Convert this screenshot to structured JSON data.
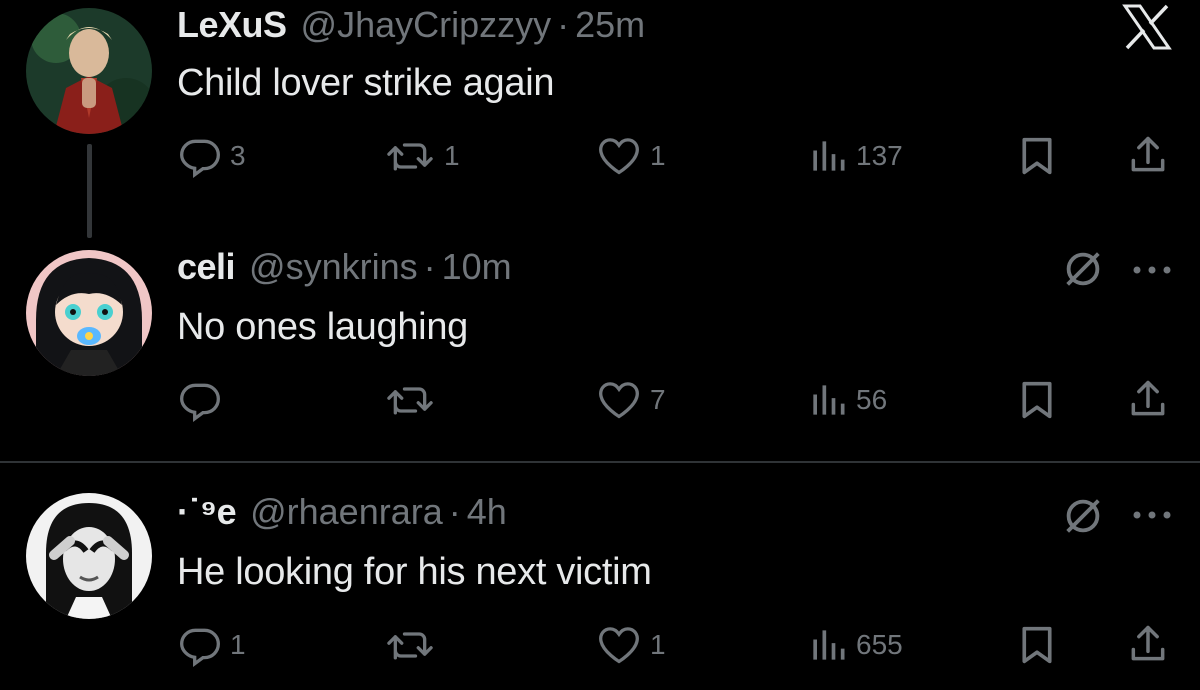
{
  "app": {
    "logo_icon": "x-logo-icon"
  },
  "tweets": [
    {
      "name": "LeXuS",
      "handle": "@JhayCripzzyy",
      "dot": "·",
      "time": "25m",
      "text": "Child lover strike again",
      "replies": "3",
      "retweets": "1",
      "likes": "1",
      "views": "137"
    },
    {
      "name": "celi",
      "handle": "@synkrins",
      "dot": "·",
      "time": "10m",
      "text": "No ones laughing",
      "replies": "",
      "retweets": "",
      "likes": "7",
      "views": "56"
    },
    {
      "name": "·˙⁹e",
      "handle": "@rhaenrara",
      "dot": "·",
      "time": "4h",
      "text": "He looking for his next victim",
      "replies": "1",
      "retweets": "",
      "likes": "1",
      "views": "655"
    }
  ],
  "icons": {
    "reply": "reply-icon",
    "retweet": "retweet-icon",
    "like": "heart-icon",
    "views": "views-icon",
    "bookmark": "bookmark-icon",
    "share": "share-icon",
    "mute": "mute-icon",
    "more": "more-icon"
  },
  "colors": {
    "background": "#000000",
    "text": "#e7e9ea",
    "muted": "#71767b",
    "divider": "#2f3336"
  }
}
